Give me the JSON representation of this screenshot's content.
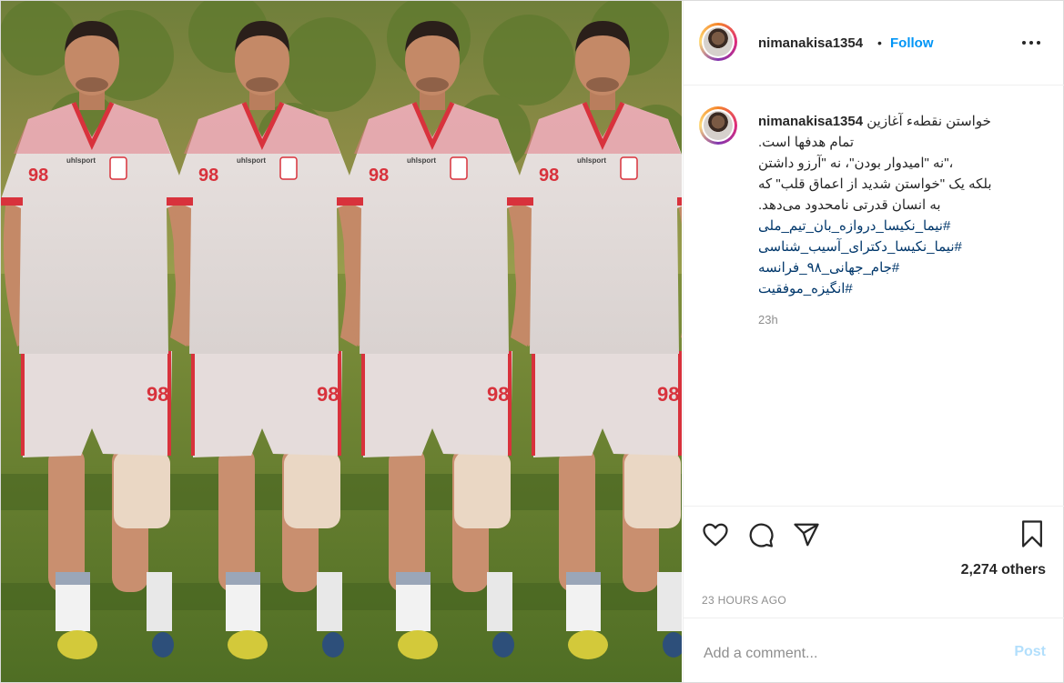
{
  "post": {
    "username": "nimanakisa1354",
    "separator": "•",
    "follow_label": "Follow",
    "more_icon": "more-options-icon",
    "caption": {
      "username": "nimanakisa1354",
      "lines": [
        "خواستن نقطهء آغازین",
        "تمام هدفها است.",
        "،\"نه \"امیدوار بودن\"، نه \"آرزو داشتن",
        "بلکه یک \"خواستن شدید از اعماق قلب\" که",
        "به انسان قدرتی نامحدود می‌دهد."
      ],
      "hashtags": [
        "#نیما_نکیسا_دروازه_بان_تیم_ملی",
        "#نیما_نکیسا_دکترای_آسیب_شناسی",
        "#جام_جهانی_۹۸_فرانسه",
        "#انگیزه_موفقیت"
      ],
      "time": "23h"
    },
    "actions": {
      "like_icon": "heart-icon",
      "comment_icon": "comment-icon",
      "share_icon": "share-icon",
      "save_icon": "bookmark-icon"
    },
    "likes_text": "2,274 others",
    "posted_ago": "23 HOURS AGO",
    "comment": {
      "placeholder": "Add a comment...",
      "post_label": "Post"
    },
    "colors": {
      "accent": "#0095f6",
      "post_disabled": "#b2dffc",
      "hashtag": "#00376b"
    },
    "media": {
      "jersey_number": "98",
      "jersey_brand": "uhlsport"
    }
  }
}
